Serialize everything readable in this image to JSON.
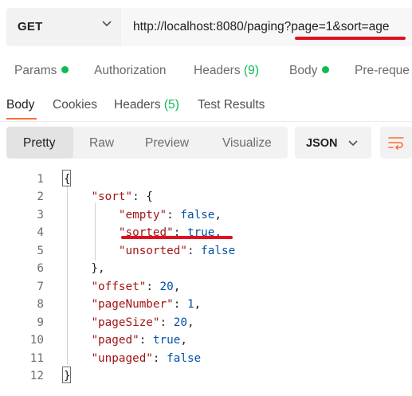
{
  "request": {
    "method": "GET",
    "url": "http://localhost:8080/paging?page=1&sort=age"
  },
  "request_tabs": [
    {
      "label": "Params",
      "dot": true
    },
    {
      "label": "Authorization"
    },
    {
      "label": "Headers",
      "count": "(9)"
    },
    {
      "label": "Body",
      "dot": true
    },
    {
      "label": "Pre-reque"
    }
  ],
  "response_tabs": [
    {
      "label": "Body",
      "active": true
    },
    {
      "label": "Cookies"
    },
    {
      "label": "Headers",
      "count": "(5)"
    },
    {
      "label": "Test Results"
    }
  ],
  "view_modes": [
    "Pretty",
    "Raw",
    "Preview",
    "Visualize"
  ],
  "active_view": "Pretty",
  "format": "JSON",
  "code_lines": [
    {
      "n": "1",
      "parts": [
        [
          "p",
          "{"
        ]
      ]
    },
    {
      "n": "2",
      "parts": [
        [
          "p",
          "    "
        ],
        [
          "k",
          "\"sort\""
        ],
        [
          "p",
          ": {"
        ]
      ]
    },
    {
      "n": "3",
      "parts": [
        [
          "p",
          "        "
        ],
        [
          "k",
          "\"empty\""
        ],
        [
          "p",
          ": "
        ],
        [
          "v",
          "false"
        ],
        [
          "p",
          ","
        ]
      ]
    },
    {
      "n": "4",
      "parts": [
        [
          "p",
          "        "
        ],
        [
          "k",
          "\"sorted\""
        ],
        [
          "p",
          ": "
        ],
        [
          "v",
          "true"
        ],
        [
          "p",
          ","
        ]
      ]
    },
    {
      "n": "5",
      "parts": [
        [
          "p",
          "        "
        ],
        [
          "k",
          "\"unsorted\""
        ],
        [
          "p",
          ": "
        ],
        [
          "v",
          "false"
        ]
      ]
    },
    {
      "n": "6",
      "parts": [
        [
          "p",
          "    },"
        ]
      ]
    },
    {
      "n": "7",
      "parts": [
        [
          "p",
          "    "
        ],
        [
          "k",
          "\"offset\""
        ],
        [
          "p",
          ": "
        ],
        [
          "v",
          "20"
        ],
        [
          "p",
          ","
        ]
      ]
    },
    {
      "n": "8",
      "parts": [
        [
          "p",
          "    "
        ],
        [
          "k",
          "\"pageNumber\""
        ],
        [
          "p",
          ": "
        ],
        [
          "v",
          "1"
        ],
        [
          "p",
          ","
        ]
      ]
    },
    {
      "n": "9",
      "parts": [
        [
          "p",
          "    "
        ],
        [
          "k",
          "\"pageSize\""
        ],
        [
          "p",
          ": "
        ],
        [
          "v",
          "20"
        ],
        [
          "p",
          ","
        ]
      ]
    },
    {
      "n": "10",
      "parts": [
        [
          "p",
          "    "
        ],
        [
          "k",
          "\"paged\""
        ],
        [
          "p",
          ": "
        ],
        [
          "v",
          "true"
        ],
        [
          "p",
          ","
        ]
      ]
    },
    {
      "n": "11",
      "parts": [
        [
          "p",
          "    "
        ],
        [
          "k",
          "\"unpaged\""
        ],
        [
          "p",
          ": "
        ],
        [
          "v",
          "false"
        ]
      ]
    },
    {
      "n": "12",
      "parts": [
        [
          "p",
          "}"
        ]
      ]
    }
  ],
  "colors": {
    "accent": "#ff6c37",
    "status_dot": "#0cbb52",
    "json_key": "#a31515",
    "json_value": "#0451a5",
    "annotation": "#e0101f"
  }
}
